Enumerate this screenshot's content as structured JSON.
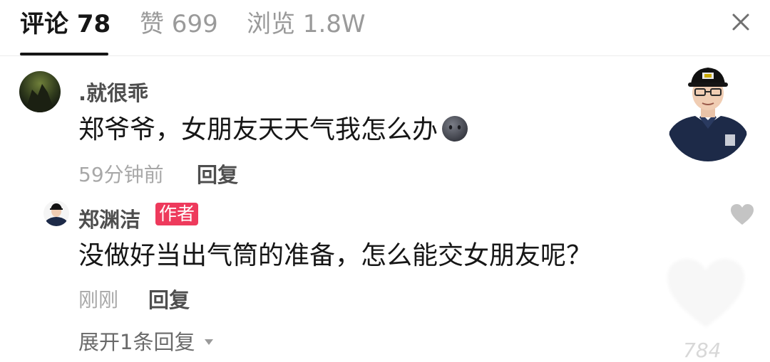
{
  "tabs": [
    {
      "label": "评论 78",
      "active": true
    },
    {
      "label": "赞 699",
      "active": false
    },
    {
      "label": "浏览 1.8W",
      "active": false
    }
  ],
  "close_icon": "close-icon",
  "comment": {
    "username": ".就很乖",
    "text": "郑爷爷，女朋友天天气我怎么办",
    "emoji": "dark-face-emoji",
    "time": "59分钟前",
    "reply_label": "回复"
  },
  "reply": {
    "username": "郑渊洁",
    "badge": "作者",
    "text": "没做好当出气筒的准备，怎么能交女朋友呢？",
    "time": "刚刚",
    "reply_label": "回复"
  },
  "expand_label": "展开1条回复",
  "bottom_count": "784",
  "colors": {
    "accent_badge": "#ee3a5c",
    "text_primary": "#161616",
    "text_muted": "#a8a8a8",
    "heart_icon": "#c4c4c4"
  }
}
